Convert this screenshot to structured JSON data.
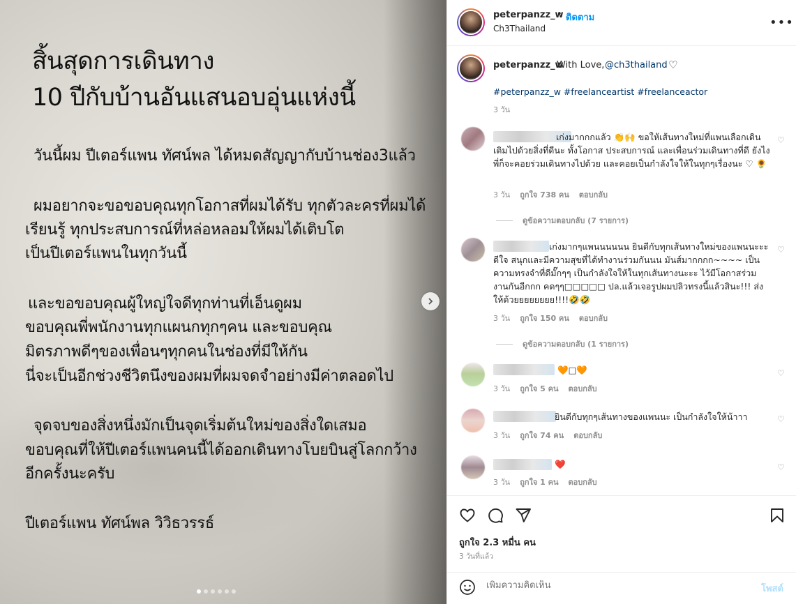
{
  "media": {
    "title_line1": "สิ้นสุดการเดินทาง",
    "title_line2": "10 ปีกับบ้านอันแสนอบอุ่นแห่งนี้",
    "paragraphs": [
      "วันนี้ผม ปีเตอร์แพน ทัศน์พล ได้หมดสัญญากับบ้านช่อง3แล้ว",
      "ผมอยากจะขอขอบคุณทุกโอกาสที่ผมได้รับ ทุกตัวละครที่ผมได้",
      "เรียนรู้ ทุกประสบการณ์ที่หล่อหลอมให้ผมได้เติบโต",
      "เป็นปีเตอร์แพนในทุกวันนี้",
      "และขอขอบคุณผู้ใหญ่ใจดีทุกท่านที่เอ็นดูผม",
      "ขอบคุณพี่พนักงานทุกแผนกทุกๆคน และขอบคุณ",
      "มิตรภาพดีๆของเพื่อนๆทุกคนในช่องที่มีให้กัน",
      "นี่จะเป็นอีกช่วงชีวิตนึงของผมที่ผมจดจำอย่างมีค่าตลอดไป",
      "จุดจบของสิ่งหนึ่งมักเป็นจุดเริ่มต้นใหม่ของสิ่งใดเสมอ",
      "ขอบคุณที่ให้ปีเตอร์แพนคนนี้ได้ออกเดินทางโบยบินสู่โลกกว้าง",
      "อีกครั้งนะครับ",
      "ปีเตอร์แพน ทัศน์พล วิวิธวรรธ์"
    ],
    "slide_count": 6,
    "active_slide": 0
  },
  "header": {
    "username": "peterpanzz_w",
    "separator": "•",
    "follow_label": "ติดตาม",
    "subtitle": "Ch3Thailand",
    "more_icon": "more-horizontal-icon"
  },
  "caption": {
    "username": "peterpanzz_w",
    "text": "With Love,",
    "mention": "@ch3thailand",
    "hashtags": "#peterpanzz_w #freelanceartist #freelanceactor",
    "time": "3 วัน"
  },
  "comments": [
    {
      "text": "เก่งมากกกแล้ว 👏🙌 ขอให้เส้นทางใหม่ที่แพนเลือกเดิน เติมไปด้วยสิ่งที่ดีนะ ทั้งโอกาส ประสบการณ์ และเพื่อนร่วมเดินทางที่ดี ยังไงพี่ก็จะคอยร่วมเดินทางไปด้วย และคอยเป็นกำลังใจให้ในทุกๆเรื่องนะ ♡ 🌻",
      "time": "3 วัน",
      "likes": "ถูกใจ 738 คน",
      "reply": "ตอบกลับ",
      "view_replies": "ดูข้อความตอบกลับ (7 รายการ)"
    },
    {
      "text": "เก่งมากๆแพนนนนนน ยินดีกับทุกเส้นทางใหม่ของแพนนะะะ ดีใจ สนุกและมีความสุขที่ได้ทำงานร่วมกันนน มันส์มากกกก~~~~ เป็นความทรงจำที่ดีมั๊กๆๆ เป็นกำลังใจให้ในทุกเส้นทางนะะะ ไว้มีโอกาสร่วมงานกันอีกกก คดๆๆ□□□□□ ปล.แล้วเจอรูปผมปลิวทรงนี้แล้วสินะ!!! ส่งให้ด้วยยยยยยยย!!!!🤣🤣",
      "time": "3 วัน",
      "likes": "ถูกใจ 150 คน",
      "reply": "ตอบกลับ",
      "view_replies": "ดูข้อความตอบกลับ (1 รายการ)"
    },
    {
      "text": "🧡□🧡",
      "time": "3 วัน",
      "likes": "ถูกใจ 5 คน",
      "reply": "ตอบกลับ"
    },
    {
      "text": "ยินดีกับทุกๆเส้นทางของแพนนะ เป็นกำลังใจให้น้าาา",
      "time": "3 วัน",
      "likes": "ถูกใจ 74 คน",
      "reply": "ตอบกลับ"
    },
    {
      "text": "❤️",
      "time": "3 วัน",
      "likes": "ถูกใจ 1 คน",
      "reply": "ตอบกลับ"
    }
  ],
  "actions": {
    "likes": "ถูกใจ 2.3 หมื่น คน",
    "posted_ago": "3 วันที่แล้ว"
  },
  "add_comment": {
    "placeholder": "เพิ่มความคิดเห็น",
    "post_label": "โพสต์"
  }
}
